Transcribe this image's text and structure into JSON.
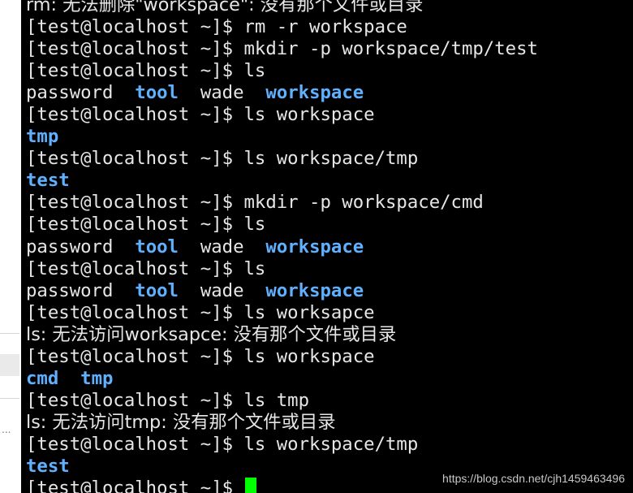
{
  "terminal": {
    "prompt": "[test@localhost ~]$ ",
    "lines": [
      {
        "kind": "output",
        "text": "rm: 无法删除\"workspace\": 没有那个文件或目录"
      },
      {
        "kind": "command",
        "cmd": "rm -r workspace"
      },
      {
        "kind": "command",
        "cmd": "mkdir -p workspace/tmp/test"
      },
      {
        "kind": "command",
        "cmd": "ls"
      },
      {
        "kind": "ls",
        "entries": [
          {
            "name": "password",
            "dir": false
          },
          {
            "name": "tool",
            "dir": true
          },
          {
            "name": "wade",
            "dir": false
          },
          {
            "name": "workspace",
            "dir": true
          }
        ]
      },
      {
        "kind": "command",
        "cmd": "ls workspace"
      },
      {
        "kind": "ls",
        "entries": [
          {
            "name": "tmp",
            "dir": true
          }
        ]
      },
      {
        "kind": "command",
        "cmd": "ls workspace/tmp"
      },
      {
        "kind": "ls",
        "entries": [
          {
            "name": "test",
            "dir": true
          }
        ]
      },
      {
        "kind": "command",
        "cmd": "mkdir -p workspace/cmd"
      },
      {
        "kind": "command",
        "cmd": "ls"
      },
      {
        "kind": "ls",
        "entries": [
          {
            "name": "password",
            "dir": false
          },
          {
            "name": "tool",
            "dir": true
          },
          {
            "name": "wade",
            "dir": false
          },
          {
            "name": "workspace",
            "dir": true
          }
        ]
      },
      {
        "kind": "command",
        "cmd": "ls"
      },
      {
        "kind": "ls",
        "entries": [
          {
            "name": "password",
            "dir": false
          },
          {
            "name": "tool",
            "dir": true
          },
          {
            "name": "wade",
            "dir": false
          },
          {
            "name": "workspace",
            "dir": true
          }
        ]
      },
      {
        "kind": "command",
        "cmd": "ls worksapce"
      },
      {
        "kind": "output",
        "text": "ls: 无法访问worksapce: 没有那个文件或目录"
      },
      {
        "kind": "command",
        "cmd": "ls workspace"
      },
      {
        "kind": "ls",
        "entries": [
          {
            "name": "cmd",
            "dir": true
          },
          {
            "name": "tmp",
            "dir": true
          }
        ]
      },
      {
        "kind": "command",
        "cmd": "ls tmp"
      },
      {
        "kind": "output",
        "text": "ls: 无法访问tmp: 没有那个文件或目录"
      },
      {
        "kind": "command",
        "cmd": "ls workspace/tmp"
      },
      {
        "kind": "ls",
        "entries": [
          {
            "name": "test",
            "dir": true
          }
        ]
      },
      {
        "kind": "input",
        "cmd": ""
      }
    ]
  },
  "side_panel": {
    "ellipsis": "..."
  },
  "watermark": "https://blog.csdn.net/cjh1459463496",
  "colors": {
    "background": "#000000",
    "text": "#e6e6e6",
    "directory": "#5fb0ff",
    "cursor": "#00ff00"
  }
}
